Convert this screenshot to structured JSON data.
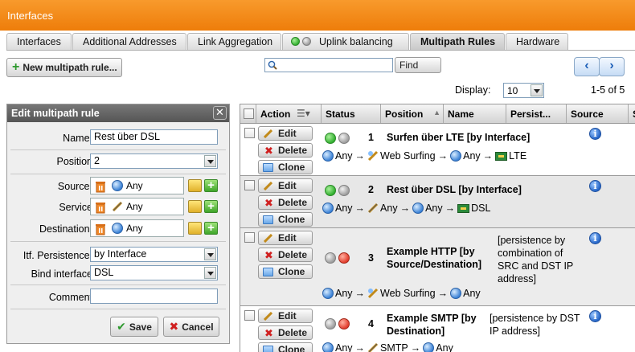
{
  "window": {
    "title": "Interfaces"
  },
  "tabs": [
    {
      "label": "Interfaces"
    },
    {
      "label": "Additional Addresses"
    },
    {
      "label": "Link Aggregation"
    },
    {
      "label": "Uplink balancing"
    },
    {
      "label": "Multipath Rules"
    },
    {
      "label": "Hardware"
    }
  ],
  "toolbar": {
    "new_rule_label": "New multipath rule...",
    "search_value": "",
    "find_label": "Find",
    "prev_icon": "chevron-left-icon",
    "next_icon": "chevron-right-icon"
  },
  "display": {
    "label": "Display:",
    "value": "10",
    "page_info": "1-5 of 5"
  },
  "edit_panel": {
    "title": "Edit multipath rule",
    "name_label": "Name:",
    "name_value": "Rest über DSL",
    "position_label": "Position",
    "position_value": "2",
    "source_label": "Source:",
    "source_value": "Any",
    "service_label": "Service",
    "service_value": "Any",
    "destination_label": "Destination:",
    "destination_value": "Any",
    "persistence_label": "Itf. Persistence:",
    "persistence_value": "by Interface",
    "bind_label": "Bind interface",
    "bind_value": "DSL",
    "comment_label": "Comment",
    "comment_value": "",
    "save_label": "Save",
    "cancel_label": "Cancel"
  },
  "table": {
    "columns": [
      "Action",
      "Status",
      "Position",
      "Name",
      "Persist...",
      "Source",
      "S"
    ],
    "buttons": {
      "edit": "Edit",
      "delete": "Delete",
      "clone": "Clone"
    },
    "rows": [
      {
        "position": "1",
        "name": "Surfen über LTE [by Interface]",
        "persistence": "",
        "path_source": "Any",
        "path_service": "Web Surfing",
        "path_dest": "Any",
        "path_iface": "LTE",
        "status": "enabled"
      },
      {
        "position": "2",
        "name": "Rest über DSL [by Interface]",
        "persistence": "",
        "path_source": "Any",
        "path_service": "Any",
        "path_dest": "Any",
        "path_iface": "DSL",
        "status": "enabled"
      },
      {
        "position": "3",
        "name": "Example HTTP [by Source/Destination]",
        "persistence": "[persistence by combination of SRC and DST IP address]",
        "path_source": "Any",
        "path_service": "Web Surfing",
        "path_dest": "Any",
        "status": "disabled"
      },
      {
        "position": "4",
        "name": "Example SMTP [by Destination]",
        "persistence": "[persistence by DST IP address]",
        "path_source": "Any",
        "path_service": "SMTP",
        "path_dest": "Any",
        "status": "disabled"
      }
    ]
  }
}
